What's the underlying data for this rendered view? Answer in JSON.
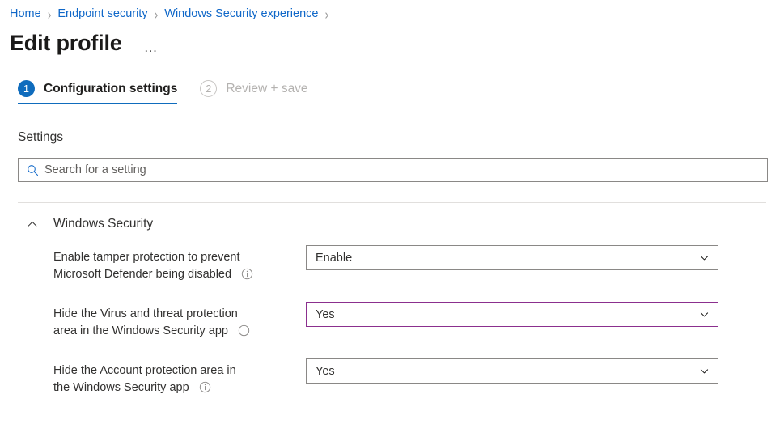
{
  "breadcrumb": {
    "separator": "›",
    "items": [
      {
        "label": "Home"
      },
      {
        "label": "Endpoint security"
      },
      {
        "label": "Windows Security experience"
      }
    ]
  },
  "header": {
    "title": "Edit profile",
    "more_label": "…"
  },
  "tabs": [
    {
      "number": "1",
      "label": "Configuration settings",
      "state": "active"
    },
    {
      "number": "2",
      "label": "Review + save",
      "state": "inactive"
    }
  ],
  "settings": {
    "heading": "Settings",
    "search": {
      "placeholder": "Search for a setting",
      "value": "",
      "icon": "search-icon"
    },
    "section": {
      "title": "Windows Security",
      "expanded": true,
      "collapse_icon": "chevron-up-icon"
    },
    "rows": [
      {
        "label_line1": "Enable tamper protection to prevent",
        "label_line2": "Microsoft Defender being disabled",
        "info_icon": "info-icon",
        "value": "Enable",
        "focused": false
      },
      {
        "label_line1": "Hide the Virus and threat protection",
        "label_line2": "area in the Windows Security app",
        "info_icon": "info-icon",
        "value": "Yes",
        "focused": true
      },
      {
        "label_line1": "Hide the Account protection area in",
        "label_line2": "the Windows Security app",
        "info_icon": "info-icon",
        "value": "Yes",
        "focused": false
      }
    ]
  },
  "colors": {
    "link": "#0f67c8",
    "accent": "#0f6cbd",
    "focus_border": "#8b2f8e",
    "border": "#8a8886",
    "divider": "#e1dfdd",
    "text": "#323130",
    "muted": "#b4b2b0"
  }
}
